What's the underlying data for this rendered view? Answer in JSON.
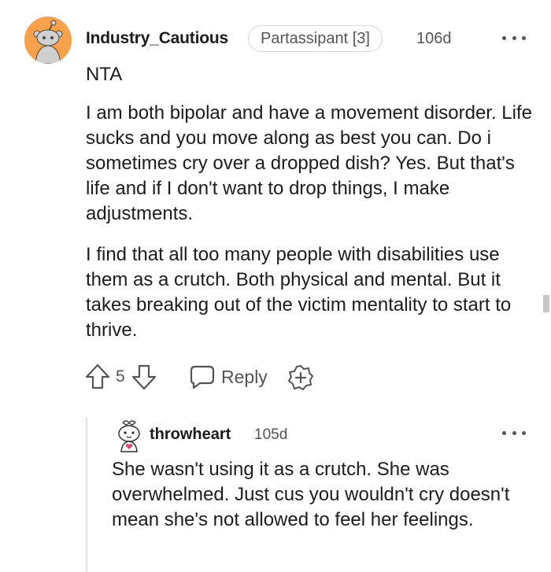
{
  "comment": {
    "username": "Industry_Cautious",
    "flair": "Partassipant [3]",
    "timestamp": "106d",
    "verdict": "NTA",
    "paragraphs": [
      "I am both bipolar and have a movement disorder. Life sucks and you move along as best you can. Do i sometimes cry over a dropped dish? Yes. But that's life and if I don't want to drop things, I make adjustments.",
      "I find that all too many people with disabilities use them as a crutch. Both physical and mental. But it takes breaking out of the victim mentality to start to thrive."
    ],
    "score": "5",
    "reply_label": "Reply",
    "avatar_color": "#f7a24a"
  },
  "reply": {
    "username": "throwheart",
    "timestamp": "105d",
    "body": "She wasn't using it as a crutch. She was overwhelmed. Just cus you wouldn't cry doesn't mean she's not allowed to feel her feelings."
  },
  "icons": {
    "upvote": "arrow-up-outline",
    "downvote": "arrow-down-outline",
    "reply": "speech-bubble-outline",
    "award": "plus-badge-outline",
    "more": "three-dots-horizontal"
  },
  "colors": {
    "text_primary": "#1c1c1c",
    "text_secondary": "#555555",
    "thread_line": "#e2e2e2",
    "flair_border": "#d6d6d6"
  }
}
